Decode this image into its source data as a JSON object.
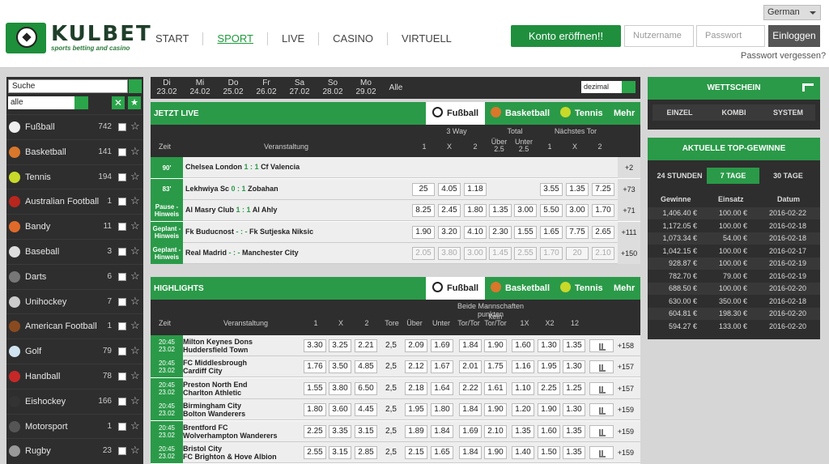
{
  "brand": {
    "name": "KULBET",
    "tagline": "sports betting and casino"
  },
  "nav": [
    "START",
    "SPORT",
    "LIVE",
    "CASINO",
    "VIRTUELL"
  ],
  "language": "German",
  "auth": {
    "open_account": "Konto eröffnen!!",
    "username_placeholder": "Nutzername",
    "password_placeholder": "Passwort",
    "login": "Einloggen",
    "forgot": "Passwort vergessen?"
  },
  "sidebar": {
    "search_placeholder": "Suche",
    "filter": "alle",
    "close": "✕",
    "star": "★",
    "sports": [
      {
        "name": "Fußball",
        "count": "742",
        "color": "#eee"
      },
      {
        "name": "Basketball",
        "count": "141",
        "color": "#d9772a"
      },
      {
        "name": "Tennis",
        "count": "194",
        "color": "#c8d92a"
      },
      {
        "name": "Australian Football",
        "count": "1",
        "color": "#b8261e"
      },
      {
        "name": "Bandy",
        "count": "11",
        "color": "#e06a2a"
      },
      {
        "name": "Baseball",
        "count": "3",
        "color": "#ddd"
      },
      {
        "name": "Darts",
        "count": "6",
        "color": "#777"
      },
      {
        "name": "Unihockey",
        "count": "7",
        "color": "#ccc"
      },
      {
        "name": "American Football",
        "count": "1",
        "color": "#8a4a20"
      },
      {
        "name": "Golf",
        "count": "79",
        "color": "#cfe3f0"
      },
      {
        "name": "Handball",
        "count": "78",
        "color": "#c62828"
      },
      {
        "name": "Eishockey",
        "count": "166",
        "color": "#333"
      },
      {
        "name": "Motorsport",
        "count": "1",
        "color": "#555"
      },
      {
        "name": "Rugby",
        "count": "23",
        "color": "#999"
      }
    ]
  },
  "dates": [
    [
      "Di",
      "23.02"
    ],
    [
      "Mi",
      "24.02"
    ],
    [
      "Do",
      "25.02"
    ],
    [
      "Fr",
      "26.02"
    ],
    [
      "Sa",
      "27.02"
    ],
    [
      "So",
      "28.02"
    ],
    [
      "Mo",
      "29.02"
    ]
  ],
  "dates_all": "Alle",
  "odds_format": "dezimal",
  "live": {
    "title": "JETZT LIVE",
    "tabs": [
      "Fußball",
      "Basketball",
      "Tennis",
      "Mehr"
    ],
    "groups": {
      "way3": "3 Way",
      "total": "Total",
      "next": "Nächstes Tor"
    },
    "cols": {
      "time": "Zeit",
      "event": "Veranstaltung",
      "c1": "1",
      "cx": "X",
      "c2": "2",
      "over": "Über 2.5",
      "under": "Unter 2.5",
      "n1": "1",
      "nx": "X",
      "n2": "2"
    },
    "rows": [
      {
        "time": "90'",
        "home": "Chelsea London",
        "score": "1 : 1",
        "away": "Cf Valencia",
        "odds": [],
        "more": "+2"
      },
      {
        "time": "83'",
        "home": "Lekhwiya Sc",
        "score": "0 : 1",
        "away": "Zobahan",
        "odds": [
          "25",
          "4.05",
          "1.18",
          "",
          "",
          "3.55",
          "1.35",
          "7.25"
        ],
        "more": "+73"
      },
      {
        "time": "Pause - Hinweis",
        "home": "Al Masry Club",
        "score": "1 : 1",
        "away": "Al Ahly",
        "odds": [
          "8.25",
          "2.45",
          "1.80",
          "1.35",
          "3.00",
          "5.50",
          "3.00",
          "1.70"
        ],
        "more": "+71"
      },
      {
        "time": "Geplant - Hinweis",
        "home": "Fk Buducnost",
        "score": "- : -",
        "away": "Fk Sutjeska Niksic",
        "odds": [
          "1.90",
          "3.20",
          "4.10",
          "2.30",
          "1.55",
          "1.65",
          "7.75",
          "2.65"
        ],
        "more": "+111"
      },
      {
        "time": "Geplant - Hinweis",
        "home": "Real Madrid",
        "score": "- : -",
        "away": "Manchester City",
        "odds": [
          "2.05",
          "3.80",
          "3.00",
          "1.45",
          "2.55",
          "1.70",
          "20",
          "2.10"
        ],
        "more": "+150",
        "disabled": true
      }
    ]
  },
  "highlights": {
    "title": "HIGHLIGHTS",
    "tabs": [
      "Fußball",
      "Basketball",
      "Tennis",
      "Mehr"
    ],
    "cols": {
      "time": "Zeit",
      "event": "Veranstaltung",
      "c1": "1",
      "cx": "X",
      "c2": "2",
      "tore": "Tore",
      "over": "Über",
      "under": "Unter",
      "both": "Beide Mannschaften punkten",
      "tt": "Tor/Tor",
      "ktt": "kein Tor/Tor",
      "d1x": "1X",
      "dx2": "X2",
      "d12": "12"
    },
    "rows": [
      {
        "time": "20:45",
        "date": "23.02",
        "home": "Milton Keynes Dons",
        "away": "Huddersfield Town",
        "odds": [
          "3.30",
          "3.25",
          "2.21",
          "2,5",
          "2.09",
          "1.69",
          "1.84",
          "1.90",
          "1.60",
          "1.30",
          "1.35"
        ],
        "more": "+158"
      },
      {
        "time": "20:45",
        "date": "23.02",
        "home": "FC Middlesbrough",
        "away": "Cardiff City",
        "odds": [
          "1.76",
          "3.50",
          "4.85",
          "2,5",
          "2.12",
          "1.67",
          "2.01",
          "1.75",
          "1.16",
          "1.95",
          "1.30"
        ],
        "more": "+157"
      },
      {
        "time": "20:45",
        "date": "23.02",
        "home": "Preston North End",
        "away": "Charlton Athletic",
        "odds": [
          "1.55",
          "3.80",
          "6.50",
          "2,5",
          "2.18",
          "1.64",
          "2.22",
          "1.61",
          "1.10",
          "2.25",
          "1.25"
        ],
        "more": "+157"
      },
      {
        "time": "20:45",
        "date": "23.02",
        "home": "Birmingham City",
        "away": "Bolton Wanderers",
        "odds": [
          "1.80",
          "3.60",
          "4.45",
          "2,5",
          "1.95",
          "1.80",
          "1.84",
          "1.90",
          "1.20",
          "1.90",
          "1.30"
        ],
        "more": "+159"
      },
      {
        "time": "20:45",
        "date": "23.02",
        "home": "Brentford FC",
        "away": "Wolverhampton Wanderers",
        "odds": [
          "2.25",
          "3.35",
          "3.15",
          "2,5",
          "1.89",
          "1.84",
          "1.69",
          "2.10",
          "1.35",
          "1.60",
          "1.35"
        ],
        "more": "+159"
      },
      {
        "time": "20:45",
        "date": "23.02",
        "home": "Bristol City",
        "away": "FC Brighton & Hove Albion",
        "odds": [
          "2.55",
          "3.15",
          "2.85",
          "2,5",
          "2.15",
          "1.65",
          "1.84",
          "1.90",
          "1.40",
          "1.50",
          "1.35"
        ],
        "more": "+159"
      }
    ]
  },
  "betslip": {
    "title": "WETTSCHEIN",
    "tabs": [
      "EINZEL",
      "KOMBI",
      "SYSTEM"
    ]
  },
  "top_wins": {
    "title": "AKTUELLE TOP-GEWINNE",
    "tabs": [
      "24 STUNDEN",
      "7 TAGE",
      "30 TAGE"
    ],
    "cols": [
      "Gewinne",
      "Einsatz",
      "Datum"
    ],
    "rows": [
      [
        "1,406.40 €",
        "100.00 €",
        "2016-02-22"
      ],
      [
        "1,172.05 €",
        "100.00 €",
        "2016-02-18"
      ],
      [
        "1,073.34 €",
        "54.00 €",
        "2016-02-18"
      ],
      [
        "1,042.15 €",
        "100.00 €",
        "2016-02-17"
      ],
      [
        "928.87 €",
        "100.00 €",
        "2016-02-19"
      ],
      [
        "782.70 €",
        "79.00 €",
        "2016-02-19"
      ],
      [
        "688.50 €",
        "100.00 €",
        "2016-02-20"
      ],
      [
        "630.00 €",
        "350.00 €",
        "2016-02-18"
      ],
      [
        "604.81 €",
        "198.30 €",
        "2016-02-20"
      ],
      [
        "594.27 €",
        "133.00 €",
        "2016-02-20"
      ]
    ]
  },
  "colors": {
    "green": "#2a9a48",
    "dark": "#2e2e2e"
  }
}
